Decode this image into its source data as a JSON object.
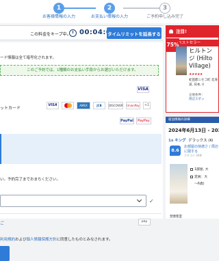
{
  "steps": [
    {
      "num": "1",
      "label": "お客様情報の入力",
      "state": "done"
    },
    {
      "num": "2",
      "label": "お支払い情報の入力",
      "state": "current"
    },
    {
      "num": "3",
      "label": "ご予約申し込み完了",
      "state": "todo"
    }
  ],
  "timer": {
    "text": "この料金をキープ中。",
    "value": "00:04:09",
    "extend_label": "タイムリミットを延長する"
  },
  "payment": {
    "card_note": "ード情報は全て暗号化されます。",
    "promo": "このご予約では、1種類のお支払い手段からお選びいただけます。",
    "credit_label": "ットカード",
    "brands": [
      "VISA",
      "MC",
      "AMEX",
      "JCB",
      "DISCOVER",
      "UnionPay"
    ],
    "plus_count": "+1",
    "visa_small": "VISA",
    "paypal": "PayPal",
    "paypay": "PayPay",
    "method_note": "い。予約完了までおまちください。",
    "letter": "ご",
    "zero": "pay",
    "terms_prefix": "",
    "terms_link1": "利用規約",
    "terms_mid": "および",
    "terms_link2": "個人情報保護方針",
    "terms_suffix": "に同意したものとみなされます。"
  },
  "hotel": {
    "attention": "注目!",
    "bestseller": "ベストセラー",
    "discount": "75% OFF",
    "name": "ヒルトン ジ (Hilto Village)",
    "stars": "★★★★★",
    "address": "虻田郡ニセコ町 北海道, 日本, 0",
    "nearby": "立地条件：",
    "nearby2": "周辺スポッ"
  },
  "stay": {
    "header": "宿泊情報の詳細",
    "dates": "2024年6月13日 - 2024年",
    "room_count": "1x キング",
    "room_name": "デラックス (Ki",
    "score": "8.6",
    "score_link": "お部屋の快適さ / 周辺に関する",
    "score_count": "クチコミ 00件",
    "room_lines": [
      "1部屋, 大",
      "定員：大",
      "〜6歳)"
    ],
    "nosmoke": "禁煙客室"
  }
}
